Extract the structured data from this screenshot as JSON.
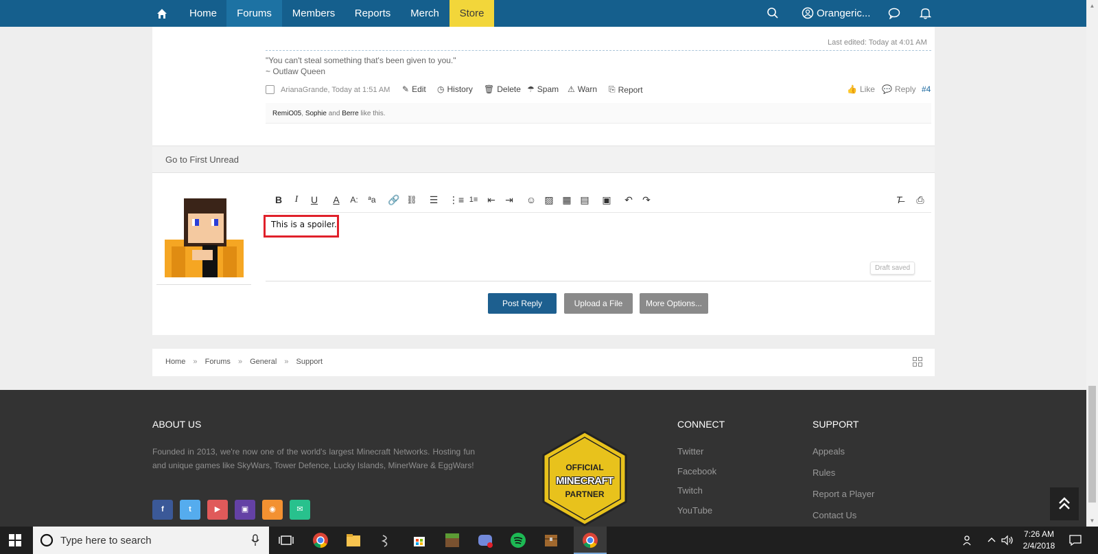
{
  "nav": {
    "home_icon": "home-icon",
    "items": [
      "Home",
      "Forums",
      "Members",
      "Reports",
      "Merch",
      "Store"
    ],
    "username": "Orangeric...",
    "search_icon": "search-icon",
    "chat_icon": "chat-icon",
    "bell_icon": "bell-icon"
  },
  "post": {
    "last_edited": "Last edited: Today at 4:01 AM",
    "quote_line1": "\"You can't steal something that's been given to you.\"",
    "quote_line2": "~ Outlaw Queen",
    "author_meta": "ArianaGrande, Today at 1:51 AM",
    "actions": [
      "Edit",
      "History",
      "Delete",
      "Spam",
      "Warn",
      "Report"
    ],
    "like": "Like",
    "reply": "Reply",
    "post_number": "#4",
    "likes_users": [
      "RemiO05",
      "Sophie",
      "Berre"
    ],
    "likes_sep1": ", ",
    "likes_sep2": " and ",
    "likes_suffix": " like this."
  },
  "go_first_unread": "Go to First Unread",
  "editor": {
    "content": "This is a spoiler.",
    "draft_saved": "Draft saved"
  },
  "buttons": {
    "post_reply": "Post Reply",
    "upload": "Upload a File",
    "more_options": "More Options..."
  },
  "breadcrumb": {
    "items": [
      "Home",
      "Forums",
      "General",
      "Support"
    ],
    "sep": "»"
  },
  "footer": {
    "about_title": "ABOUT US",
    "about_text": "Founded in 2013, we're now one of the world's largest Minecraft Networks. Hosting fun and unique games like SkyWars, Tower Defence, Lucky Islands, MinerWare & EggWars!",
    "badge_line1": "OFFICIAL",
    "badge_line2": "MINECRAFT",
    "badge_line3": "PARTNER",
    "connect_title": "CONNECT",
    "connect_links": [
      "Twitter",
      "Facebook",
      "Twitch",
      "YouTube"
    ],
    "support_title": "SUPPORT",
    "support_links": [
      "Appeals",
      "Rules",
      "Report a Player",
      "Contact Us"
    ],
    "social": [
      {
        "name": "facebook",
        "glyph": "f",
        "color": "#3b5998"
      },
      {
        "name": "twitter",
        "glyph": "t",
        "color": "#55acee"
      },
      {
        "name": "youtube",
        "glyph": "▶",
        "color": "#e05a5a"
      },
      {
        "name": "twitch",
        "glyph": "▣",
        "color": "#6441a5"
      },
      {
        "name": "rss",
        "glyph": "◉",
        "color": "#f39131"
      },
      {
        "name": "email",
        "glyph": "✉",
        "color": "#28c18d"
      }
    ]
  },
  "taskbar": {
    "search_placeholder": "Type here to search",
    "time": "7:26 AM",
    "date": "2/4/2018"
  }
}
